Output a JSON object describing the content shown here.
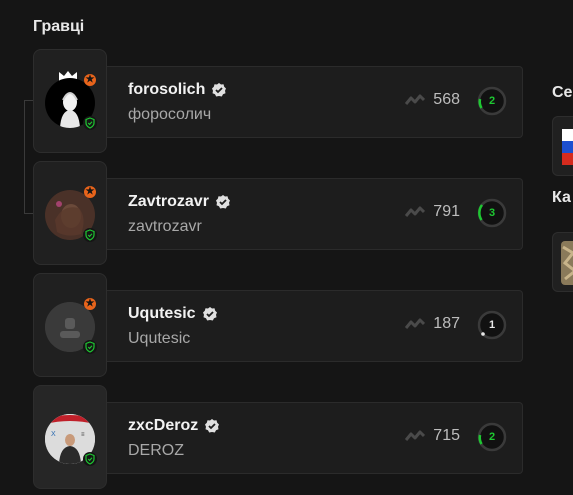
{
  "section": {
    "title": "Гравці"
  },
  "players": [
    {
      "nickname": "forosolich",
      "name": "форосолич",
      "elo": "568",
      "level": "2",
      "level_color": "#1ec832",
      "rank_badge": true,
      "leader": true,
      "avatar": "inked-portrait"
    },
    {
      "nickname": "Zavtrozavr",
      "name": "zavtrozavr",
      "elo": "791",
      "level": "3",
      "level_color": "#1ec832",
      "rank_badge": true,
      "leader": false,
      "avatar": "brown-portrait"
    },
    {
      "nickname": "Uqutesic",
      "name": "Uqutesic",
      "elo": "187",
      "level": "1",
      "level_color": "#e8e8e8",
      "rank_badge": true,
      "leader": false,
      "avatar": "default-avatar"
    },
    {
      "nickname": "zxcDeroz",
      "name": "DEROZ",
      "elo": "715",
      "level": "2",
      "level_color": "#1ec832",
      "rank_badge": false,
      "leader": false,
      "avatar": "event-photo"
    }
  ],
  "right_panel": {
    "server_label": "Се",
    "map_label": "Ка"
  },
  "icons": {
    "verified": "verified-icon",
    "elo": "elo-trend-icon",
    "shield": "shield-icon",
    "crown": "crown-icon",
    "flag": "russia-flag-icon"
  },
  "colors": {
    "accent": "#e8641b",
    "level_green": "#1ec832",
    "background": "#151515"
  }
}
